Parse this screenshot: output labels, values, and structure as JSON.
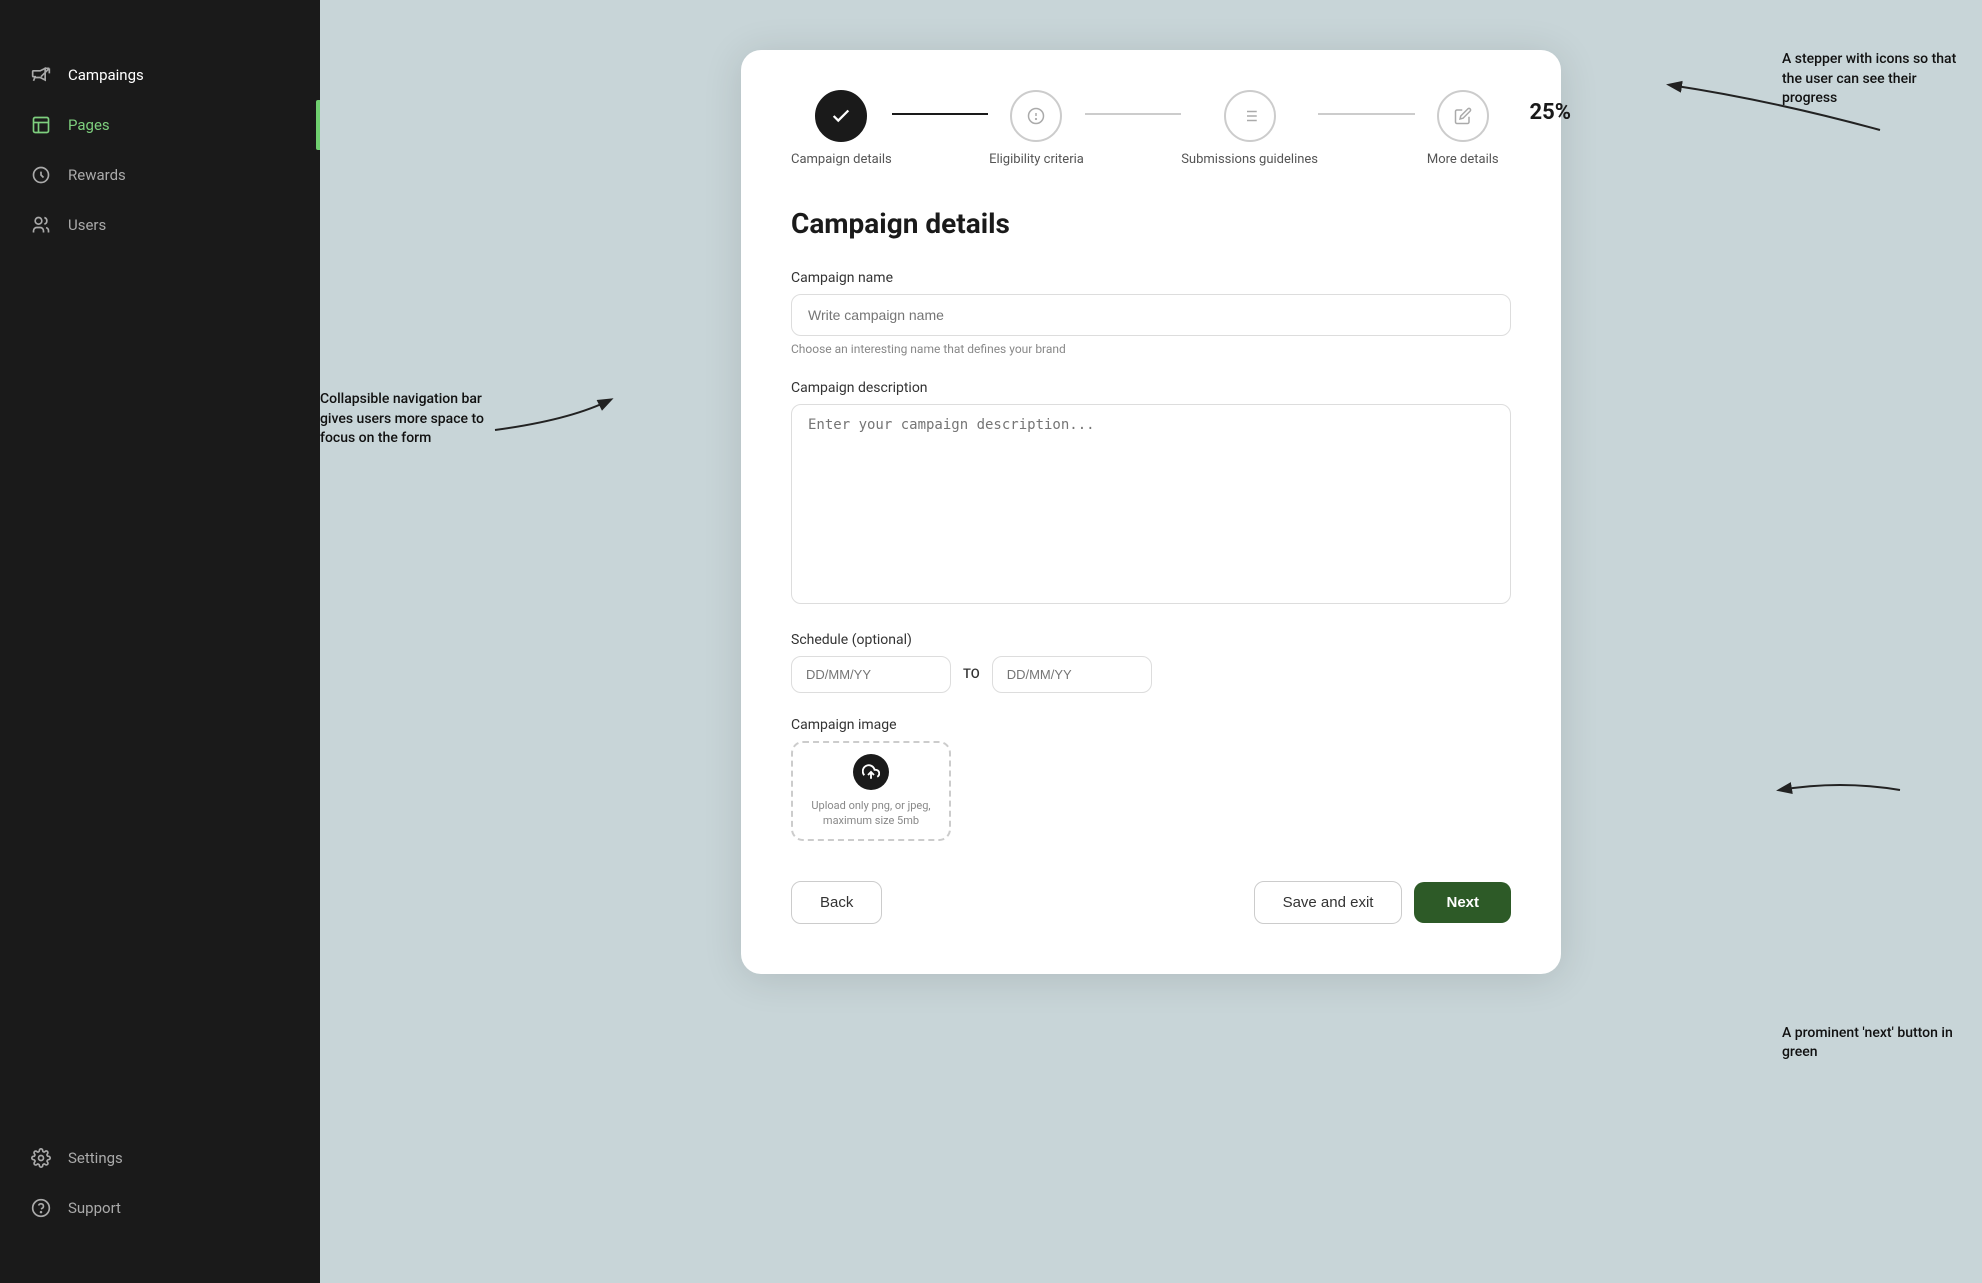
{
  "sidebar": {
    "items": [
      {
        "id": "campaigns",
        "label": "Campaings",
        "icon": "megaphone",
        "active": false
      },
      {
        "id": "pages",
        "label": "Pages",
        "icon": "pages",
        "active": true
      },
      {
        "id": "rewards",
        "label": "Rewards",
        "icon": "rewards",
        "active": false
      },
      {
        "id": "users",
        "label": "Users",
        "icon": "users",
        "active": false
      }
    ],
    "bottom_items": [
      {
        "id": "settings",
        "label": "Settings",
        "icon": "settings"
      },
      {
        "id": "support",
        "label": "Support",
        "icon": "support"
      }
    ]
  },
  "stepper": {
    "progress_label": "25%",
    "steps": [
      {
        "id": "campaign-details",
        "label": "Campaign details",
        "state": "active",
        "icon": "check"
      },
      {
        "id": "eligibility-criteria",
        "label": "Eligibility criteria",
        "state": "inactive",
        "icon": "clock"
      },
      {
        "id": "submissions-guidelines",
        "label": "Submissions guidelines",
        "state": "inactive",
        "icon": "list"
      },
      {
        "id": "more-details",
        "label": "More details",
        "state": "inactive",
        "icon": "edit"
      }
    ]
  },
  "form": {
    "title": "Campaign details",
    "campaign_name_label": "Campaign name",
    "campaign_name_placeholder": "Write campaign name",
    "campaign_name_hint": "Choose an interesting name that defines your brand",
    "campaign_description_label": "Campaign description",
    "campaign_description_placeholder": "Enter your campaign description...",
    "schedule_label": "Schedule (optional)",
    "schedule_from_placeholder": "DD/MM/YY",
    "schedule_to_label": "TO",
    "schedule_to_placeholder": "DD/MM/YY",
    "campaign_image_label": "Campaign image",
    "upload_hint": "Upload only png, or jpeg, maximum size 5mb"
  },
  "buttons": {
    "back_label": "Back",
    "save_exit_label": "Save and exit",
    "next_label": "Next"
  },
  "annotations": {
    "left": "Collapsible navigation bar gives users more space to focus on the form",
    "top_right": "A stepper with icons so that the user can see their progress",
    "bottom_right": "A prominent 'next' button in green"
  }
}
